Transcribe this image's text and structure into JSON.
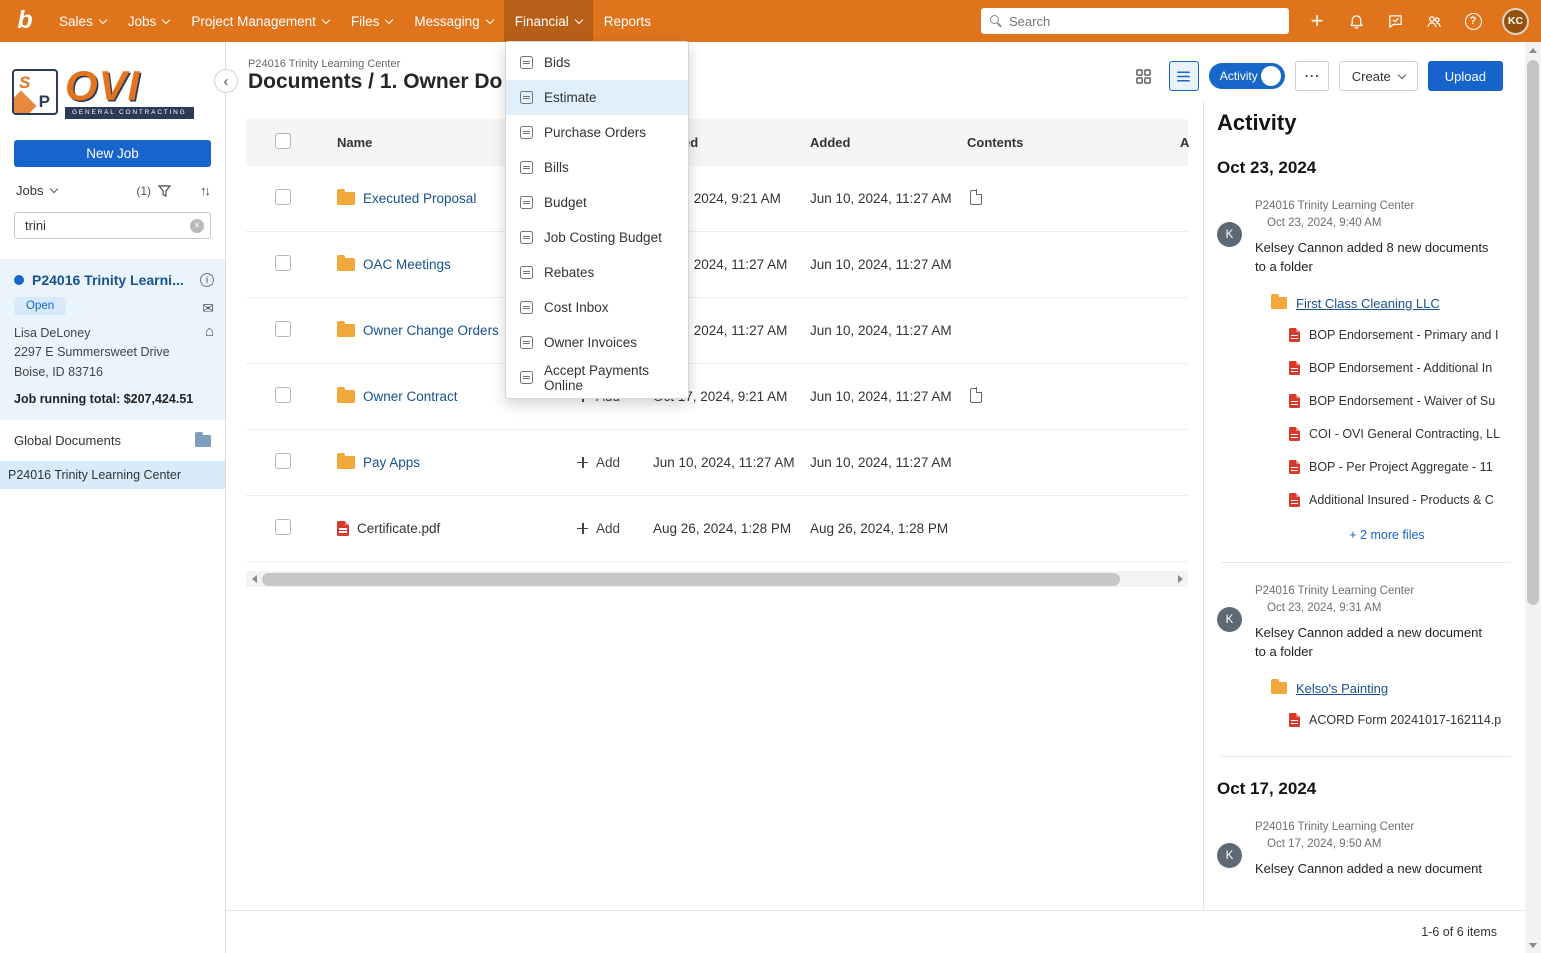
{
  "topnav": {
    "logo_letter": "b",
    "items": [
      {
        "label": "Sales",
        "caret": true
      },
      {
        "label": "Jobs",
        "caret": true
      },
      {
        "label": "Project Management",
        "caret": true
      },
      {
        "label": "Files",
        "caret": true
      },
      {
        "label": "Messaging",
        "caret": true
      },
      {
        "label": "Financial",
        "caret": true,
        "active": true
      },
      {
        "label": "Reports",
        "caret": false
      }
    ],
    "search_placeholder": "Search",
    "avatar_initials": "KC"
  },
  "financial_menu": {
    "items": [
      {
        "label": "Bids",
        "icon": "bids-icon"
      },
      {
        "label": "Estimate",
        "icon": "estimate-icon",
        "selected": true
      },
      {
        "label": "Purchase Orders",
        "icon": "purchase-orders-icon"
      },
      {
        "label": "Bills",
        "icon": "bills-icon"
      },
      {
        "label": "Budget",
        "icon": "budget-icon"
      },
      {
        "label": "Job Costing Budget",
        "icon": "job-costing-budget-icon"
      },
      {
        "label": "Rebates",
        "icon": "rebates-icon"
      },
      {
        "label": "Cost Inbox",
        "icon": "cost-inbox-icon"
      },
      {
        "label": "Owner Invoices",
        "icon": "owner-invoices-icon"
      },
      {
        "label": "Accept Payments Online",
        "icon": "accept-payments-icon"
      }
    ]
  },
  "sidebar": {
    "brand": {
      "name": "OVI",
      "tagline": "GENERAL CONTRACTING",
      "badge_top": "S",
      "badge_bottom": "P"
    },
    "new_job_label": "New Job",
    "jobs_dropdown_label": "Jobs",
    "filter_count": "(1)",
    "sort_glyph": "↑↓",
    "search_value": "trini",
    "job_card": {
      "title": "P24016 Trinity Learni...",
      "status": "Open",
      "contact_name": "Lisa DeLoney",
      "address_line1": "2297 E Summersweet Drive",
      "address_line2": "Boise, ID 83716",
      "running_total": "Job running total: $207,424.51"
    },
    "global_documents_label": "Global Documents",
    "selected_job": "P24016 Trinity Learning Center"
  },
  "main": {
    "breadcrumb": "P24016 Trinity Learning Center",
    "title": "Documents / 1. Owner Do",
    "toolbar": {
      "activity_toggle_label": "Activity",
      "more_label": "⋯",
      "create_label": "Create",
      "upload_label": "Upload"
    },
    "table": {
      "columns": {
        "name": "Name",
        "modified_partial": "ed",
        "added": "Added",
        "contents": "Contents",
        "last_partial": "A"
      },
      "rows": [
        {
          "name": "Executed Proposal",
          "is_folder": true,
          "modified": "2024, 9:21 AM",
          "modified_partial": true,
          "added": "Jun 10, 2024, 11:27 AM",
          "has_contents": true
        },
        {
          "name": "OAC Meetings",
          "is_folder": true,
          "modified": "2024, 11:27 AM",
          "modified_partial": true,
          "added": "Jun 10, 2024, 11:27 AM"
        },
        {
          "name": "Owner Change Orders",
          "is_folder": true,
          "modified": "2024, 11:27 AM",
          "modified_partial": true,
          "added": "Jun 10, 2024, 11:27 AM"
        },
        {
          "name": "Owner Contract",
          "is_folder": true,
          "show_add": true,
          "add_label": "Add",
          "modified": "Oct 17, 2024, 9:21 AM",
          "added": "Jun 10, 2024, 11:27 AM",
          "has_contents": true
        },
        {
          "name": "Pay Apps",
          "is_folder": true,
          "show_add": true,
          "add_label": "Add",
          "modified": "Jun 10, 2024, 11:27 AM",
          "added": "Jun 10, 2024, 11:27 AM"
        },
        {
          "name": "Certificate.pdf",
          "is_pdf": true,
          "show_add": true,
          "add_label": "Add",
          "modified": "Aug 26, 2024, 1:28 PM",
          "added": "Aug 26, 2024, 1:28 PM"
        }
      ]
    },
    "pagination": "1-6 of 6 items"
  },
  "activity_panel": {
    "title": "Activity",
    "sections": [
      {
        "date": "Oct 23, 2024",
        "items": [
          {
            "avatar_initial": "K",
            "job": "P24016 Trinity Learning Center",
            "time": "Oct 23, 2024, 9:40 AM",
            "action": "Kelsey Cannon added 8 new documents to a folder",
            "folder": "First Class Cleaning LLC",
            "files": [
              "BOP Endorsement - Primary and I",
              "BOP Endorsement - Additional In",
              "BOP Endorsement - Waiver of Su",
              "COI - OVI General Contracting, LL",
              "BOP - Per Project Aggregate - 11",
              "Additional Insured - Products & C"
            ],
            "more_files_label": "+ 2 more files"
          },
          {
            "avatar_initial": "K",
            "job": "P24016 Trinity Learning Center",
            "time": "Oct 23, 2024, 9:31 AM",
            "action": "Kelsey Cannon added a new document to a folder",
            "folder": "Kelso's Painting",
            "files": [
              "ACORD Form 20241017-162114.p"
            ]
          }
        ]
      },
      {
        "date": "Oct 17, 2024",
        "items": [
          {
            "avatar_initial": "K",
            "job": "P24016 Trinity Learning Center",
            "time": "Oct 17, 2024, 9:50 AM",
            "action": "Kelsey Cannon added a new document"
          }
        ]
      }
    ]
  }
}
